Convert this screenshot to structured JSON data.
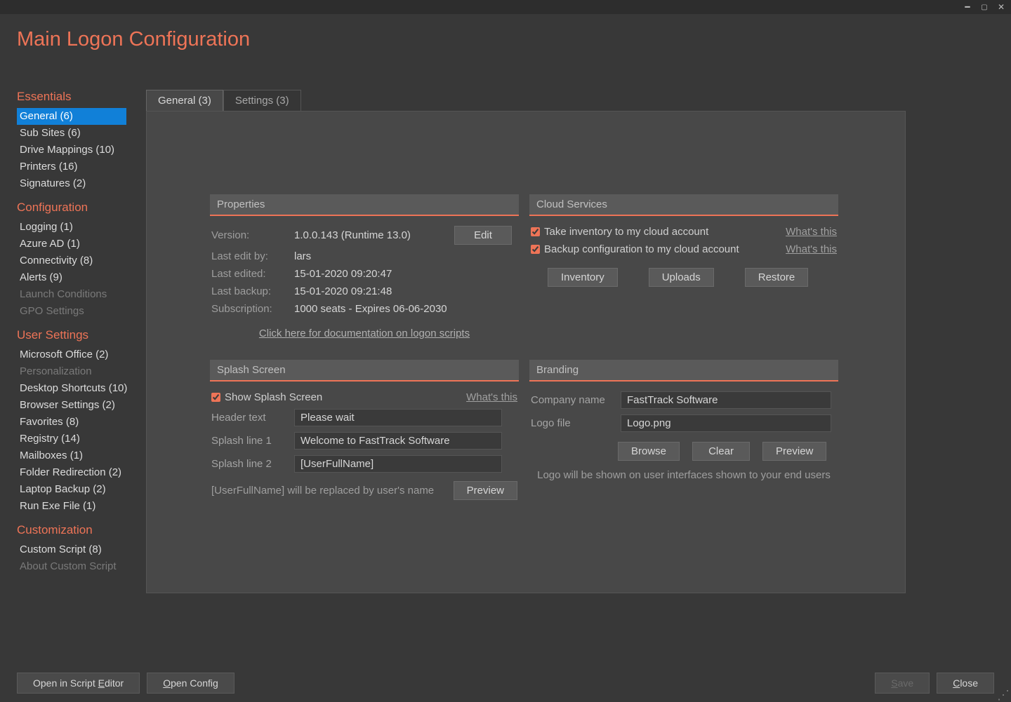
{
  "title": "Main Logon Configuration",
  "tabs": {
    "general": "General (3)",
    "settings": "Settings (3)"
  },
  "nav": {
    "essentials": {
      "hdr": "Essentials",
      "items": [
        "General (6)",
        "Sub Sites (6)",
        "Drive Mappings (10)",
        "Printers (16)",
        "Signatures (2)"
      ]
    },
    "configuration": {
      "hdr": "Configuration",
      "items": [
        "Logging (1)",
        "Azure AD (1)",
        "Connectivity (8)",
        "Alerts (9)",
        "Launch Conditions",
        "GPO Settings"
      ]
    },
    "usersettings": {
      "hdr": "User Settings",
      "items": [
        "Microsoft Office (2)",
        "Personalization",
        "Desktop Shortcuts (10)",
        "Browser Settings (2)",
        "Favorites (8)",
        "Registry (14)",
        "Mailboxes (1)",
        "Folder Redirection (2)",
        "Laptop Backup (2)",
        "Run Exe File (1)"
      ]
    },
    "customization": {
      "hdr": "Customization",
      "items": [
        "Custom Script (8)",
        "About Custom Script"
      ]
    }
  },
  "props": {
    "hdr": "Properties",
    "version_l": "Version:",
    "version": "1.0.0.143 (Runtime 13.0)",
    "editby_l": "Last edit by:",
    "editby": "lars",
    "edited_l": "Last edited:",
    "edited": "15-01-2020 09:20:47",
    "backup_l": "Last backup:",
    "backup": "15-01-2020 09:21:48",
    "sub_l": "Subscription:",
    "sub": "1000 seats  -  Expires 06-06-2030",
    "edit": "Edit",
    "doclink": "Click here for documentation on logon scripts"
  },
  "cloud": {
    "hdr": "Cloud Services",
    "inv": "Take inventory to my cloud account",
    "bak": "Backup configuration to my cloud account",
    "whats": "What's this",
    "b_inv": "Inventory",
    "b_up": "Uploads",
    "b_rest": "Restore"
  },
  "splash": {
    "hdr": "Splash Screen",
    "show": "Show Splash Screen",
    "whats": "What's this",
    "hlabel": "Header text",
    "hval": "Please wait",
    "l1l": "Splash line 1",
    "l1v": "Welcome to FastTrack Software",
    "l2l": "Splash line 2",
    "l2v": "[UserFullName]",
    "hint": "[UserFullName] will be replaced by user's name",
    "preview": "Preview"
  },
  "brand": {
    "hdr": "Branding",
    "cname_l": "Company name",
    "cname": "FastTrack Software",
    "logo_l": "Logo file",
    "logo": "Logo.png",
    "browse": "Browse",
    "clear": "Clear",
    "preview": "Preview",
    "hint": "Logo will be shown on user interfaces shown to your end users"
  },
  "footer": {
    "open_editor": "Open in Script Editor",
    "open_config": "Open Config",
    "save": "Save",
    "close": "Close"
  }
}
